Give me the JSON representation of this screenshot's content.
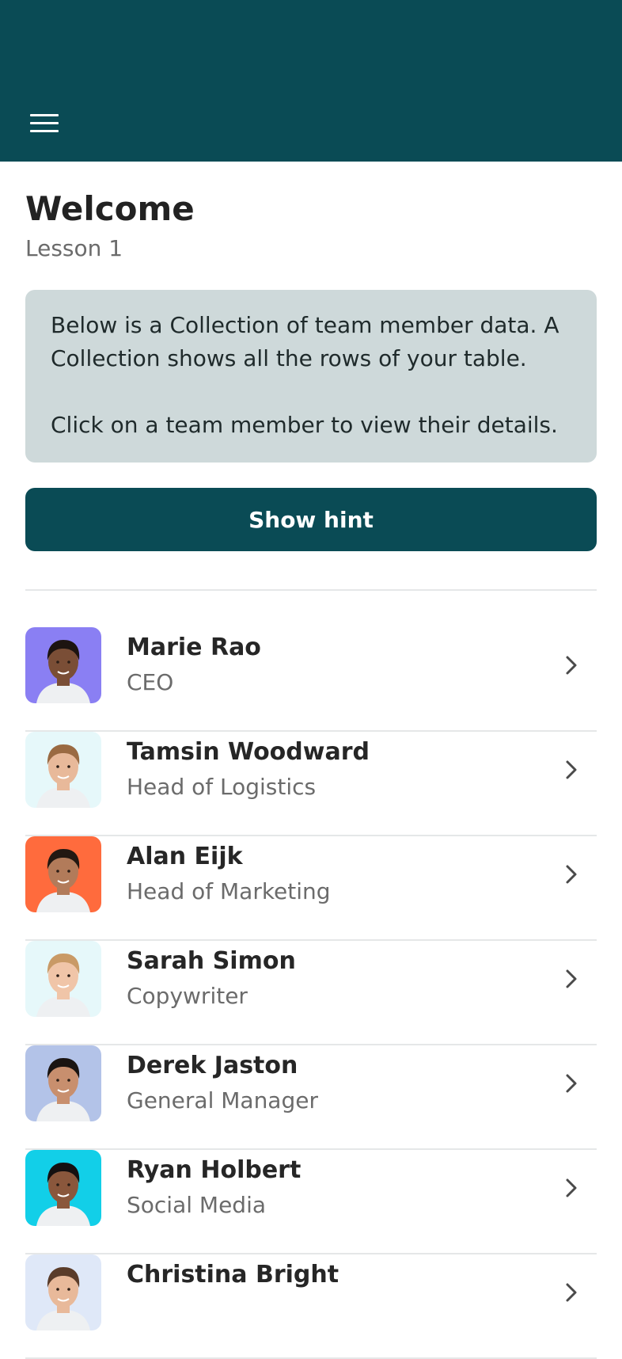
{
  "header": {
    "menu_icon": "hamburger-menu-icon",
    "background": "#0a4b55"
  },
  "page": {
    "title": "Welcome",
    "subtitle": "Lesson 1"
  },
  "info": {
    "line1": "Below is a Collection of team member data. A Collection shows all the rows of your table.",
    "line2": "Click on a team member to view their details."
  },
  "hint_button": {
    "label": "Show hint"
  },
  "team": [
    {
      "name": "Marie Rao",
      "role": "CEO",
      "avatar_bg": "#8a7ff3",
      "skin": "#7a4e36",
      "hair": "#1d1410"
    },
    {
      "name": "Tamsin Woodward",
      "role": "Head of Logistics",
      "avatar_bg": "#e6f8fa",
      "skin": "#e8b99a",
      "hair": "#9a6a42"
    },
    {
      "name": "Alan Eijk",
      "role": "Head of Marketing",
      "avatar_bg": "#ff6b3d",
      "skin": "#b27b5a",
      "hair": "#221812"
    },
    {
      "name": "Sarah Simon",
      "role": "Copywriter",
      "avatar_bg": "#e6f8fa",
      "skin": "#f0c5a8",
      "hair": "#c99a66"
    },
    {
      "name": "Derek Jaston",
      "role": "General Manager",
      "avatar_bg": "#b3c3e8",
      "skin": "#c88f6e",
      "hair": "#1a1411"
    },
    {
      "name": "Ryan Holbert",
      "role": "Social Media",
      "avatar_bg": "#12cfe8",
      "skin": "#8a573c",
      "hair": "#141010"
    },
    {
      "name": "Christina Bright",
      "role": "",
      "avatar_bg": "#dfe8f8",
      "skin": "#e8b99a",
      "hair": "#5a3c2a"
    }
  ]
}
